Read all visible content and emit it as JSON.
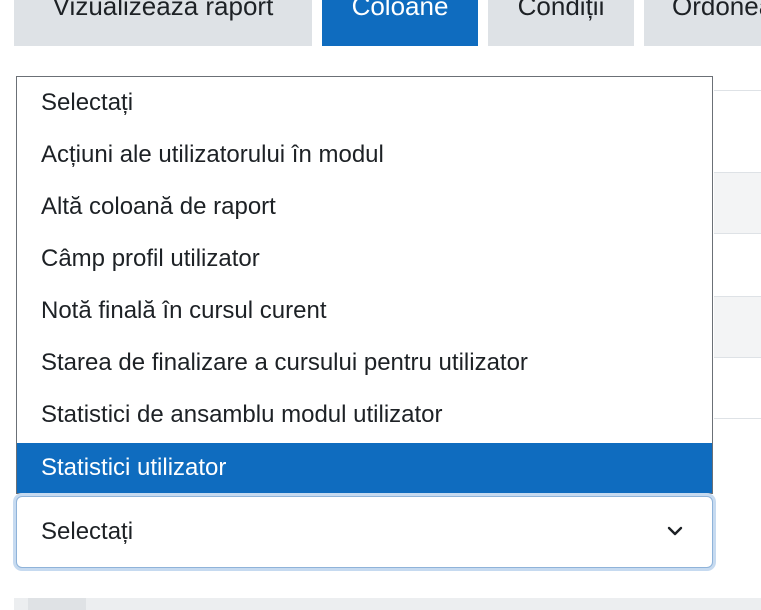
{
  "tabs": [
    {
      "label": "Vizualizează raport",
      "active": false
    },
    {
      "label": "Coloane",
      "active": true
    },
    {
      "label": "Condiții",
      "active": false
    },
    {
      "label": "Ordonează",
      "active": false
    }
  ],
  "dropdown": {
    "options": [
      "Selectați",
      "Acțiuni ale utilizatorului în modul",
      "Altă coloană de raport",
      "Câmp profil utilizator",
      "Notă finală în cursul curent",
      "Starea de finalizare a cursului pentru utilizator",
      "Statistici de ansamblu modul utilizator",
      "Statistici utilizator"
    ],
    "highlighted_index": 7
  },
  "select": {
    "value": "Selectați"
  },
  "colors": {
    "accent": "#0f6cbf",
    "tab_bg": "#dee2e6",
    "focus_ring": "#c6daf0"
  }
}
